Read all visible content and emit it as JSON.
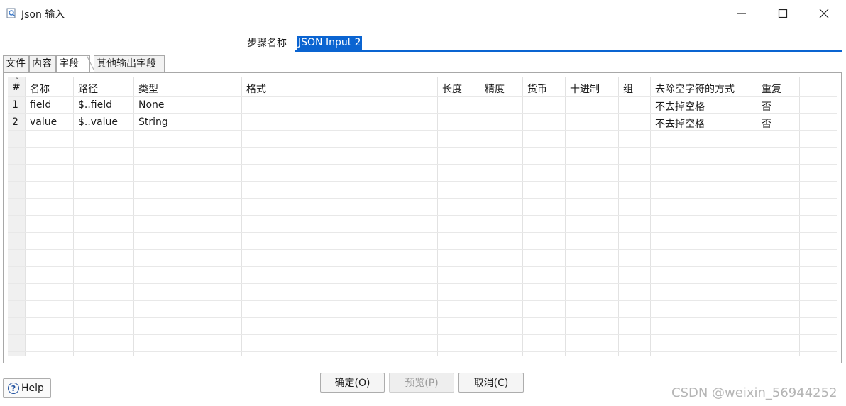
{
  "window": {
    "title": "Json 输入",
    "icon": "json-input-step-icon"
  },
  "step": {
    "label": "步骤名称",
    "value": "JSON Input 2"
  },
  "tabs": [
    {
      "label": "文件",
      "active": false
    },
    {
      "label": "内容",
      "active": false
    },
    {
      "label": "字段",
      "active": true
    },
    {
      "label": "其他输出字段",
      "active": false
    }
  ],
  "table": {
    "sort_indicator": "^",
    "headers": [
      "#",
      "名称",
      "路径",
      "类型",
      "格式",
      "长度",
      "精度",
      "货币",
      "十进制",
      "组",
      "去除空字符的方式",
      "重复"
    ],
    "rows": [
      {
        "num": "1",
        "name": "field",
        "path": "$..field",
        "type": "None",
        "format": "",
        "length": "",
        "precision": "",
        "currency": "",
        "decimal": "",
        "group": "",
        "trim": "不去掉空格",
        "repeat": "否"
      },
      {
        "num": "2",
        "name": "value",
        "path": "$..value",
        "type": "String",
        "format": "",
        "length": "",
        "precision": "",
        "currency": "",
        "decimal": "",
        "group": "",
        "trim": "不去掉空格",
        "repeat": "否"
      }
    ]
  },
  "buttons": {
    "ok": "确定(O)",
    "preview": "预览(P)",
    "cancel": "取消(C)",
    "help": "Help"
  },
  "watermark": "CSDN @weixin_56944252",
  "colors": {
    "selection": "#0a64d1",
    "help_icon": "#1f4f9e"
  }
}
